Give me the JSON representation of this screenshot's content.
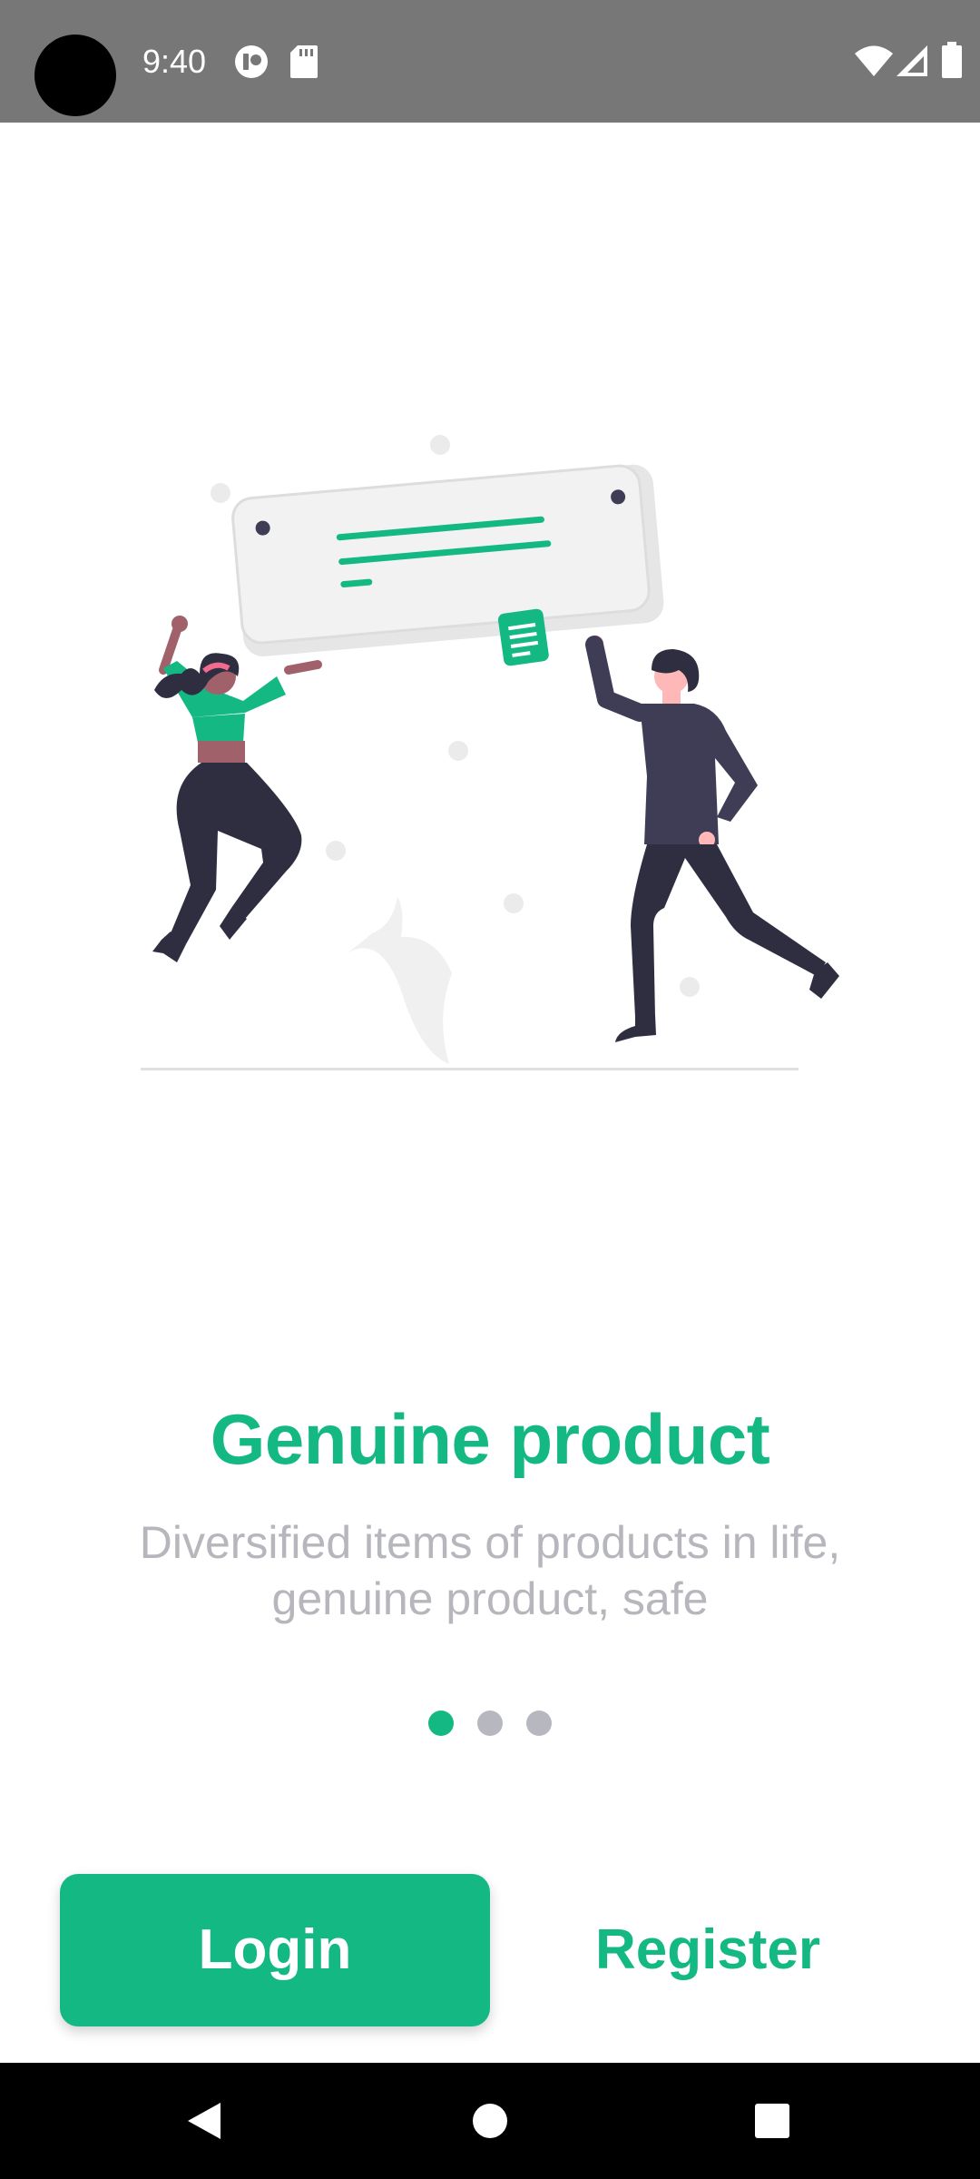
{
  "status_bar": {
    "time": "9:40",
    "icons": [
      "camera-cutout",
      "app-notification-icon",
      "sd-card-icon",
      "wifi-icon",
      "signal-icon",
      "battery-icon"
    ]
  },
  "onboarding": {
    "illustration": "two-people-holding-sign-illustration",
    "title": "Genuine product",
    "subtitle": "Diversified items of products in life, genuine product, safe",
    "page_indicator": {
      "total": 3,
      "active_index": 0
    }
  },
  "actions": {
    "login_label": "Login",
    "register_label": "Register"
  },
  "nav_bar": {
    "icons": [
      "back-icon",
      "home-icon",
      "recents-icon"
    ]
  },
  "colors": {
    "accent": "#13b883",
    "status_bar": "#777777",
    "subtitle_text": "#b6b6bd",
    "inactive_dot": "#b7b7bf",
    "nav_bar": "#000000"
  }
}
